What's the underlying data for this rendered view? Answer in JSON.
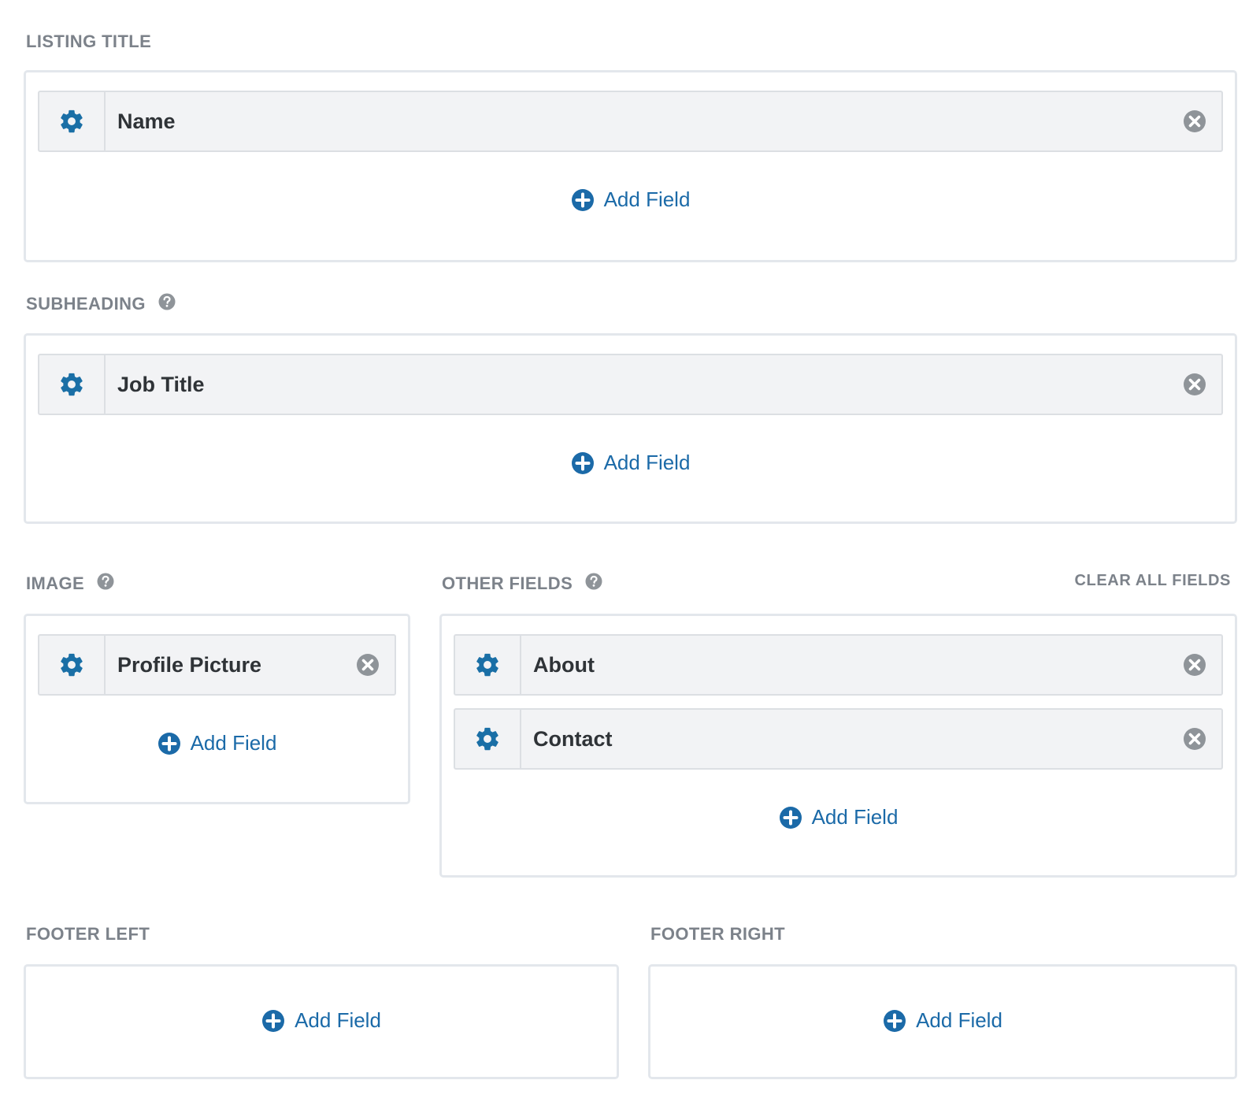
{
  "colors": {
    "accent": "#1b6aa8",
    "gear": "#1a6fa6",
    "label": "#7c828a",
    "remove": "#8f9499",
    "border": "#e3e7ec",
    "row_bg": "#f2f3f5"
  },
  "icons": {
    "settings": "gear-icon",
    "remove": "close-circle-icon",
    "add": "plus-circle-icon",
    "help": "question-circle-icon"
  },
  "sections": {
    "listing_title": {
      "label": "LISTING TITLE",
      "fields": [
        "Name"
      ],
      "add_label": "Add Field"
    },
    "subheading": {
      "label": "SUBHEADING",
      "fields": [
        "Job Title"
      ],
      "add_label": "Add Field"
    },
    "image": {
      "label": "IMAGE",
      "fields": [
        "Profile Picture"
      ],
      "add_label": "Add Field"
    },
    "other_fields": {
      "label": "OTHER FIELDS",
      "clear_label": "CLEAR ALL FIELDS",
      "fields": [
        "About",
        "Contact"
      ],
      "add_label": "Add Field"
    },
    "footer_left": {
      "label": "FOOTER LEFT",
      "fields": [],
      "add_label": "Add Field"
    },
    "footer_right": {
      "label": "FOOTER RIGHT",
      "fields": [],
      "add_label": "Add Field"
    }
  }
}
